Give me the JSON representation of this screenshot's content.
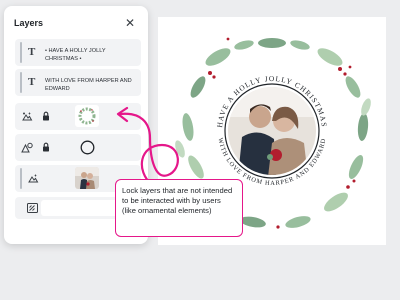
{
  "panel": {
    "title": "Layers",
    "close_glyph": "✕"
  },
  "layers": [
    {
      "kind": "text",
      "icon": "text-icon",
      "label": "• HAVE A HOLLY JOLLY CHRISTMAS •",
      "locked": false
    },
    {
      "kind": "text",
      "icon": "text-icon",
      "label": "WITH LOVE FROM HARPER AND EDWARD",
      "locked": false
    },
    {
      "kind": "image",
      "icon": "image-effects-icon",
      "thumbnail": "wreath",
      "locked": true
    },
    {
      "kind": "shape",
      "icon": "shape-icon",
      "thumbnail": "circle-outline",
      "locked": true
    },
    {
      "kind": "image",
      "icon": "image-effects-icon",
      "thumbnail": "couple-photo",
      "locked": false
    },
    {
      "kind": "background",
      "icon": "background-icon",
      "locked": false
    }
  ],
  "callout": {
    "text": "Lock layers that are not intended to be interacted with by users (like ornamental elements)"
  },
  "canvas": {
    "top_arc_text": "• HAVE A HOLLY JOLLY CHRISTMAS •",
    "bottom_arc_text": "WITH LOVE FROM HARPER AND EDWARD"
  },
  "colors": {
    "accent": "#e5178a",
    "panel_bg": "#ffffff",
    "row_bg": "#f2f3f5",
    "page_bg": "#ecedef",
    "berry": "#b21d2e",
    "leaf": "#7aa57d"
  }
}
